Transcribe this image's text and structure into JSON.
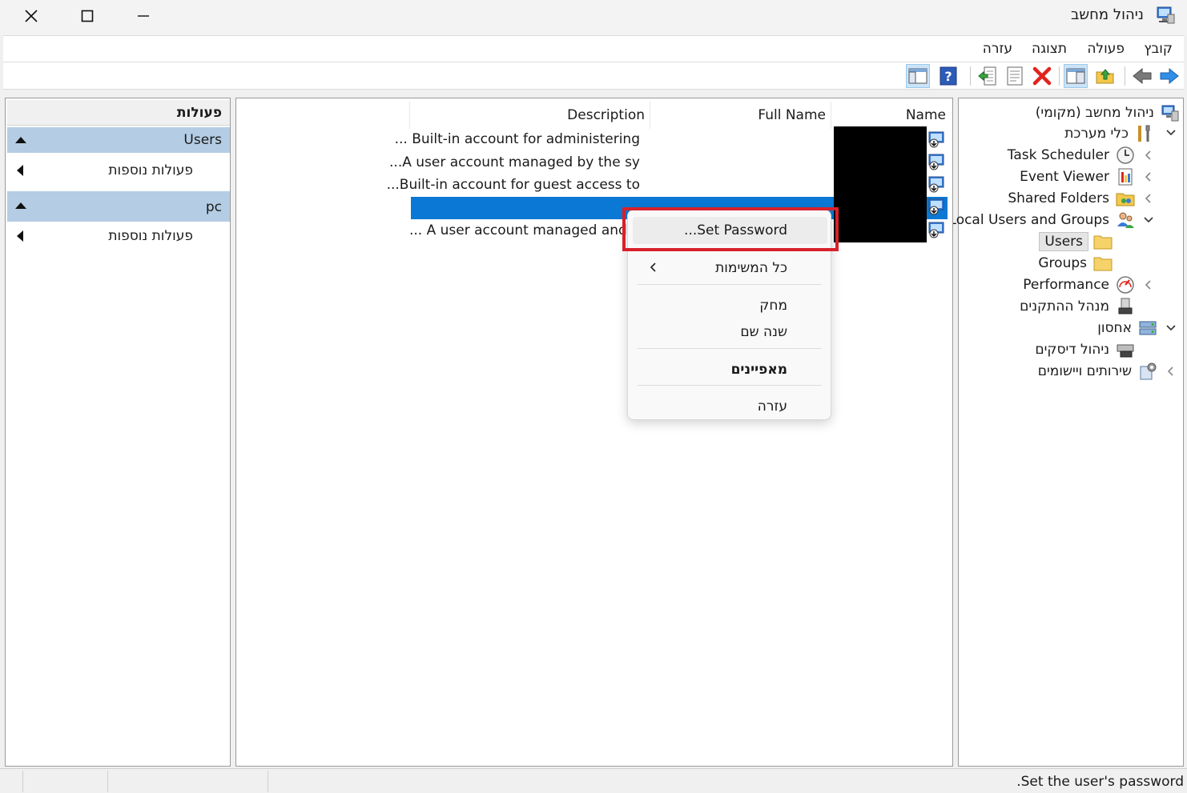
{
  "window": {
    "title": "ניהול מחשב",
    "close_label": "Close",
    "maximize_label": "Maximize",
    "minimize_label": "Minimize"
  },
  "menu": {
    "items": [
      "קובץ",
      "פעולה",
      "תצוגה",
      "עזרה"
    ]
  },
  "toolbar": {
    "buttons": [
      "back-arrow-icon",
      "forward-arrow-icon",
      "up-folder-icon",
      "show-hide-tree-icon",
      "delete-icon",
      "properties-icon",
      "export-list-icon",
      "help-icon",
      "show-hide-action-pane-icon"
    ]
  },
  "tree": {
    "root": "ניהול מחשב (מקומי)",
    "system_tools": "כלי מערכת",
    "task_scheduler": "Task Scheduler",
    "event_viewer": "Event Viewer",
    "shared_folders": "Shared Folders",
    "local_users_groups": "Local Users and Groups",
    "users": "Users",
    "groups": "Groups",
    "performance": "Performance",
    "device_manager": "מנהל ההתקנים",
    "storage": "אחסון",
    "disk_management": "ניהול דיסקים",
    "services_apps": "שירותים ויישומים"
  },
  "list": {
    "columns": {
      "name": "Name",
      "full_name": "Full Name",
      "description": "Description"
    },
    "rows": [
      {
        "description": "Built-in account for administering ..."
      },
      {
        "description": "A user account managed by the sy..."
      },
      {
        "description": "Built-in account for guest access to..."
      },
      {
        "description": ""
      },
      {
        "description": "A user account managed and u ..."
      }
    ]
  },
  "context_menu": {
    "set_password": "Set Password...",
    "all_tasks": "כל המשימות",
    "delete": "מחק",
    "rename": "שנה שם",
    "properties": "מאפיינים",
    "help": "עזרה"
  },
  "actions": {
    "header": "פעולות",
    "section1": "Users",
    "section1_more": "פעולות נוספות",
    "section2": "pc",
    "section2_more": "פעולות נוספות"
  },
  "status": {
    "text": "Set the user's password."
  },
  "colors": {
    "selection": "#0a78d4",
    "section_header": "#b4cde4",
    "highlight_box": "#d8212b"
  }
}
